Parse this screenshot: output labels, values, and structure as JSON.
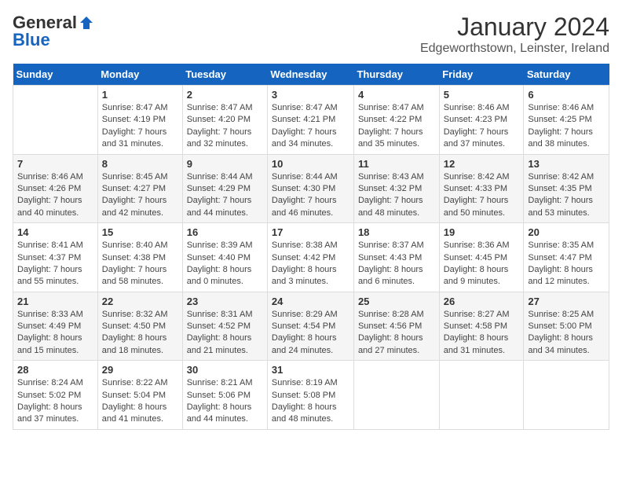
{
  "header": {
    "logo_general": "General",
    "logo_blue": "Blue",
    "title": "January 2024",
    "subtitle": "Edgeworthstown, Leinster, Ireland"
  },
  "calendar": {
    "days_of_week": [
      "Sunday",
      "Monday",
      "Tuesday",
      "Wednesday",
      "Thursday",
      "Friday",
      "Saturday"
    ],
    "weeks": [
      [
        {
          "day": "",
          "content": ""
        },
        {
          "day": "1",
          "content": "Sunrise: 8:47 AM\nSunset: 4:19 PM\nDaylight: 7 hours\nand 31 minutes."
        },
        {
          "day": "2",
          "content": "Sunrise: 8:47 AM\nSunset: 4:20 PM\nDaylight: 7 hours\nand 32 minutes."
        },
        {
          "day": "3",
          "content": "Sunrise: 8:47 AM\nSunset: 4:21 PM\nDaylight: 7 hours\nand 34 minutes."
        },
        {
          "day": "4",
          "content": "Sunrise: 8:47 AM\nSunset: 4:22 PM\nDaylight: 7 hours\nand 35 minutes."
        },
        {
          "day": "5",
          "content": "Sunrise: 8:46 AM\nSunset: 4:23 PM\nDaylight: 7 hours\nand 37 minutes."
        },
        {
          "day": "6",
          "content": "Sunrise: 8:46 AM\nSunset: 4:25 PM\nDaylight: 7 hours\nand 38 minutes."
        }
      ],
      [
        {
          "day": "7",
          "content": "Sunrise: 8:46 AM\nSunset: 4:26 PM\nDaylight: 7 hours\nand 40 minutes."
        },
        {
          "day": "8",
          "content": "Sunrise: 8:45 AM\nSunset: 4:27 PM\nDaylight: 7 hours\nand 42 minutes."
        },
        {
          "day": "9",
          "content": "Sunrise: 8:44 AM\nSunset: 4:29 PM\nDaylight: 7 hours\nand 44 minutes."
        },
        {
          "day": "10",
          "content": "Sunrise: 8:44 AM\nSunset: 4:30 PM\nDaylight: 7 hours\nand 46 minutes."
        },
        {
          "day": "11",
          "content": "Sunrise: 8:43 AM\nSunset: 4:32 PM\nDaylight: 7 hours\nand 48 minutes."
        },
        {
          "day": "12",
          "content": "Sunrise: 8:42 AM\nSunset: 4:33 PM\nDaylight: 7 hours\nand 50 minutes."
        },
        {
          "day": "13",
          "content": "Sunrise: 8:42 AM\nSunset: 4:35 PM\nDaylight: 7 hours\nand 53 minutes."
        }
      ],
      [
        {
          "day": "14",
          "content": "Sunrise: 8:41 AM\nSunset: 4:37 PM\nDaylight: 7 hours\nand 55 minutes."
        },
        {
          "day": "15",
          "content": "Sunrise: 8:40 AM\nSunset: 4:38 PM\nDaylight: 7 hours\nand 58 minutes."
        },
        {
          "day": "16",
          "content": "Sunrise: 8:39 AM\nSunset: 4:40 PM\nDaylight: 8 hours\nand 0 minutes."
        },
        {
          "day": "17",
          "content": "Sunrise: 8:38 AM\nSunset: 4:42 PM\nDaylight: 8 hours\nand 3 minutes."
        },
        {
          "day": "18",
          "content": "Sunrise: 8:37 AM\nSunset: 4:43 PM\nDaylight: 8 hours\nand 6 minutes."
        },
        {
          "day": "19",
          "content": "Sunrise: 8:36 AM\nSunset: 4:45 PM\nDaylight: 8 hours\nand 9 minutes."
        },
        {
          "day": "20",
          "content": "Sunrise: 8:35 AM\nSunset: 4:47 PM\nDaylight: 8 hours\nand 12 minutes."
        }
      ],
      [
        {
          "day": "21",
          "content": "Sunrise: 8:33 AM\nSunset: 4:49 PM\nDaylight: 8 hours\nand 15 minutes."
        },
        {
          "day": "22",
          "content": "Sunrise: 8:32 AM\nSunset: 4:50 PM\nDaylight: 8 hours\nand 18 minutes."
        },
        {
          "day": "23",
          "content": "Sunrise: 8:31 AM\nSunset: 4:52 PM\nDaylight: 8 hours\nand 21 minutes."
        },
        {
          "day": "24",
          "content": "Sunrise: 8:29 AM\nSunset: 4:54 PM\nDaylight: 8 hours\nand 24 minutes."
        },
        {
          "day": "25",
          "content": "Sunrise: 8:28 AM\nSunset: 4:56 PM\nDaylight: 8 hours\nand 27 minutes."
        },
        {
          "day": "26",
          "content": "Sunrise: 8:27 AM\nSunset: 4:58 PM\nDaylight: 8 hours\nand 31 minutes."
        },
        {
          "day": "27",
          "content": "Sunrise: 8:25 AM\nSunset: 5:00 PM\nDaylight: 8 hours\nand 34 minutes."
        }
      ],
      [
        {
          "day": "28",
          "content": "Sunrise: 8:24 AM\nSunset: 5:02 PM\nDaylight: 8 hours\nand 37 minutes."
        },
        {
          "day": "29",
          "content": "Sunrise: 8:22 AM\nSunset: 5:04 PM\nDaylight: 8 hours\nand 41 minutes."
        },
        {
          "day": "30",
          "content": "Sunrise: 8:21 AM\nSunset: 5:06 PM\nDaylight: 8 hours\nand 44 minutes."
        },
        {
          "day": "31",
          "content": "Sunrise: 8:19 AM\nSunset: 5:08 PM\nDaylight: 8 hours\nand 48 minutes."
        },
        {
          "day": "",
          "content": ""
        },
        {
          "day": "",
          "content": ""
        },
        {
          "day": "",
          "content": ""
        }
      ]
    ]
  }
}
